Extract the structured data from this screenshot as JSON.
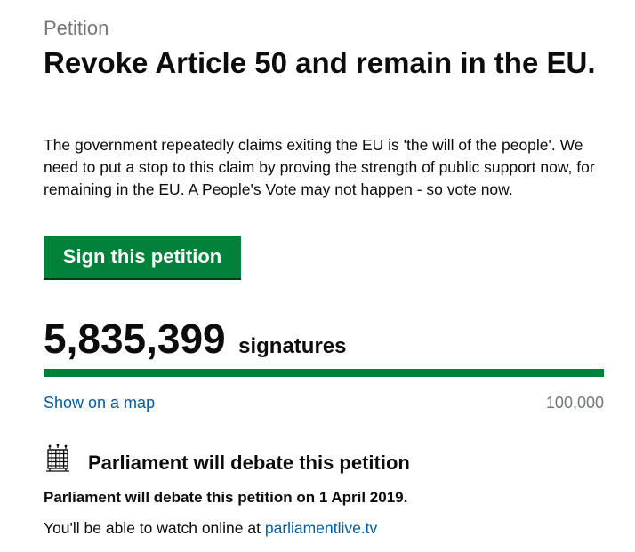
{
  "petition": {
    "caption": "Petition",
    "title": "Revoke Article 50 and remain in the EU.",
    "description": "The government repeatedly claims exiting the EU is 'the will of the people'. We need to put a stop to this claim by proving the strength of public support now, for remaining in the EU. A People's Vote may not happen - so vote now.",
    "sign_button_label": "Sign this petition"
  },
  "signatures": {
    "count": "5,835,399",
    "label": "signatures",
    "progress_fraction": 1.0,
    "threshold": "100,000",
    "map_link_label": "Show on a map"
  },
  "debate": {
    "icon": "portcullis-icon",
    "heading": "Parliament will debate this petition",
    "date_text": "Parliament will debate this petition on 1 April 2019.",
    "watch_text": "You'll be able to watch online at ",
    "watch_link_label": "parliamentlive.tv"
  },
  "colors": {
    "accent_green": "#00823b",
    "link_blue": "#005ea5",
    "muted_grey": "#6f777b"
  }
}
